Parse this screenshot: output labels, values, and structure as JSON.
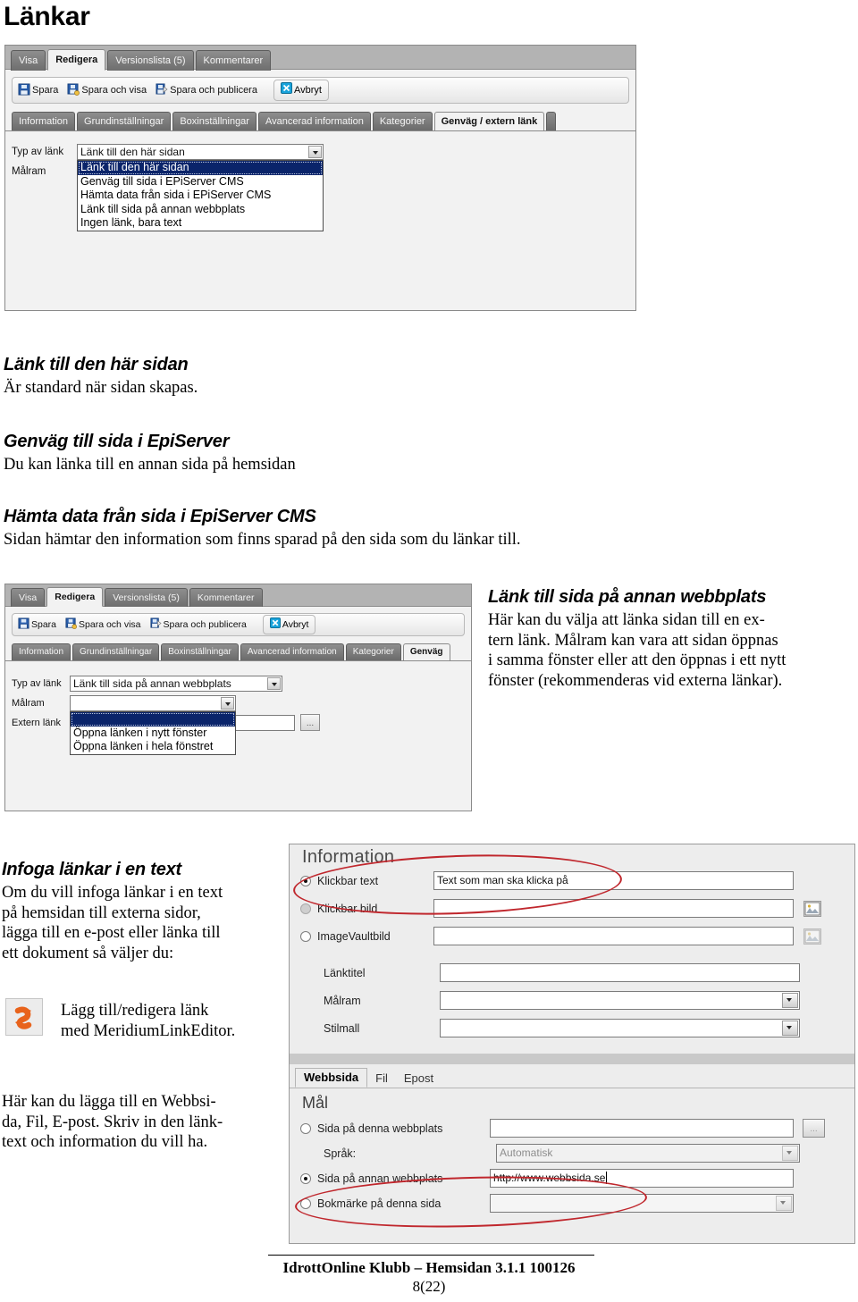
{
  "document": {
    "title": "Länkar",
    "footer_line1": "IdrottOnline Klubb – Hemsidan 3.1.1 100126",
    "footer_line2": "8(22)"
  },
  "screenshot_top": {
    "tabs": [
      {
        "label": "Visa",
        "active": false
      },
      {
        "label": "Redigera",
        "active": true
      },
      {
        "label": "Versionslista (5)",
        "active": false
      },
      {
        "label": "Kommentarer",
        "active": false
      }
    ],
    "toolbar": [
      {
        "label": "Spara",
        "icon": "save-floppy-icon"
      },
      {
        "label": "Spara och visa",
        "icon": "save-and-view-icon"
      },
      {
        "label": "Spara och publicera",
        "icon": "save-and-publish-icon"
      }
    ],
    "cancel": {
      "label": "Avbryt",
      "icon": "cancel-x-icon"
    },
    "subtabs": [
      {
        "label": "Information",
        "active": false
      },
      {
        "label": "Grundinställningar",
        "active": false
      },
      {
        "label": "Boxinställningar",
        "active": false
      },
      {
        "label": "Avancerad information",
        "active": false
      },
      {
        "label": "Kategorier",
        "active": false
      },
      {
        "label": "Genväg / extern länk",
        "active": true
      }
    ],
    "form": {
      "label_typ": "Typ av länk",
      "label_malram": "Målram",
      "combo_value": "Länk till den här sidan",
      "options": [
        "Länk till den här sidan",
        "Genväg till sida i EPiServer CMS",
        "Hämta data från sida i EPiServer CMS",
        "Länk till sida på annan webbplats",
        "Ingen länk, bara text"
      ],
      "selected_index": 0
    }
  },
  "body_sections": [
    {
      "heading": "Länk till den här sidan",
      "paragraph": "Är standard när sidan skapas."
    },
    {
      "heading": "Genväg till sida i EpiServer",
      "paragraph": "Du kan länka till en annan sida på hemsidan"
    },
    {
      "heading": "Hämta data från sida i EpiServer CMS",
      "paragraph": "Sidan hämtar den information som finns sparad på den sida som du länkar till."
    }
  ],
  "external_section": {
    "heading": "Länk till sida på annan webbplats",
    "lines": [
      "Här kan du välja att länka sidan till en ex-",
      "tern länk. Målram kan vara att sidan öppnas",
      "i samma fönster eller att den öppnas i ett nytt",
      "fönster (rekommenderas vid externa länkar)."
    ]
  },
  "screenshot_mid": {
    "tabs": [
      {
        "label": "Visa",
        "active": false
      },
      {
        "label": "Redigera",
        "active": true
      },
      {
        "label": "Versionslista (5)",
        "active": false
      },
      {
        "label": "Kommentarer",
        "active": false
      }
    ],
    "toolbar": [
      {
        "label": "Spara",
        "icon": "save-floppy-icon"
      },
      {
        "label": "Spara och visa",
        "icon": "save-and-view-icon"
      },
      {
        "label": "Spara och publicera",
        "icon": "save-and-publish-icon"
      }
    ],
    "cancel": {
      "label": "Avbryt",
      "icon": "cancel-x-icon"
    },
    "subtabs": [
      {
        "label": "Information",
        "active": false
      },
      {
        "label": "Grundinställningar",
        "active": false
      },
      {
        "label": "Boxinställningar",
        "active": false
      },
      {
        "label": "Avancerad information",
        "active": false
      },
      {
        "label": "Kategorier",
        "active": false
      },
      {
        "label": "Genväg",
        "active": true
      }
    ],
    "form": {
      "label_typ": "Typ av länk",
      "label_malram": "Målram",
      "label_extern": "Extern länk",
      "combo_value": "Länk till sida på annan webbplats",
      "malram_value": "",
      "extern_value": "",
      "malram_options": [
        "",
        "Öppna länken i nytt fönster",
        "Öppna länken i hela fönstret"
      ],
      "malram_selected_index": 0,
      "ellipsis_label": "..."
    }
  },
  "insert_section": {
    "heading": "Infoga länkar i en text",
    "lines": [
      "Om du vill infoga länkar i en text",
      "på hemsidan till externa sidor,",
      "lägga till en e-post eller länka till",
      "ett dokument så väljer du:"
    ],
    "icon_caption_line1": "Lägg till/redigera länk",
    "icon_caption_line2": "med MeridiumLinkEditor.",
    "icon_name": "meridium-link-editor-icon",
    "closing_lines": [
      "Här kan du lägga till en Webbsi-",
      "da, Fil, E-post. Skriv in den länk-",
      "text och information du vill ha."
    ]
  },
  "information_dialog": {
    "title": "Information",
    "rows": [
      {
        "label": "Klickbar text",
        "value": "Text som man ska klicka på",
        "radio": "on",
        "has_image_button": false
      },
      {
        "label": "Klickbar bild",
        "value": "",
        "radio": "dim",
        "has_image_button": true
      },
      {
        "label": "ImageVaultbild",
        "value": "",
        "radio": "off",
        "has_image_button": true
      }
    ],
    "fields": [
      {
        "label": "Länktitel",
        "value": "",
        "type": "text"
      },
      {
        "label": "Målram",
        "value": "",
        "type": "combo"
      },
      {
        "label": "Stilmall",
        "value": "",
        "type": "combo"
      }
    ],
    "annotation_color": "#c0272d"
  },
  "target_dialog": {
    "tabs": [
      {
        "label": "Webbsida",
        "active": true
      },
      {
        "label": "Fil",
        "active": false
      },
      {
        "label": "Epost",
        "active": false
      }
    ],
    "group_title": "Mål",
    "rows": [
      {
        "label": "Sida på denna webbplats",
        "value": "",
        "radio": "off",
        "type": "text",
        "has_ellipsis": true
      },
      {
        "label": "Språk:",
        "value": "Automatisk",
        "radio": "none",
        "type": "combo",
        "disabled": true
      },
      {
        "label": "Sida på annan webbplats",
        "value": "http://www.webbsida.se",
        "radio": "on",
        "type": "text"
      },
      {
        "label": "Bokmärke på denna sida",
        "value": "",
        "radio": "off",
        "type": "combo",
        "disabled": true
      }
    ],
    "ellipsis_label": "..."
  }
}
